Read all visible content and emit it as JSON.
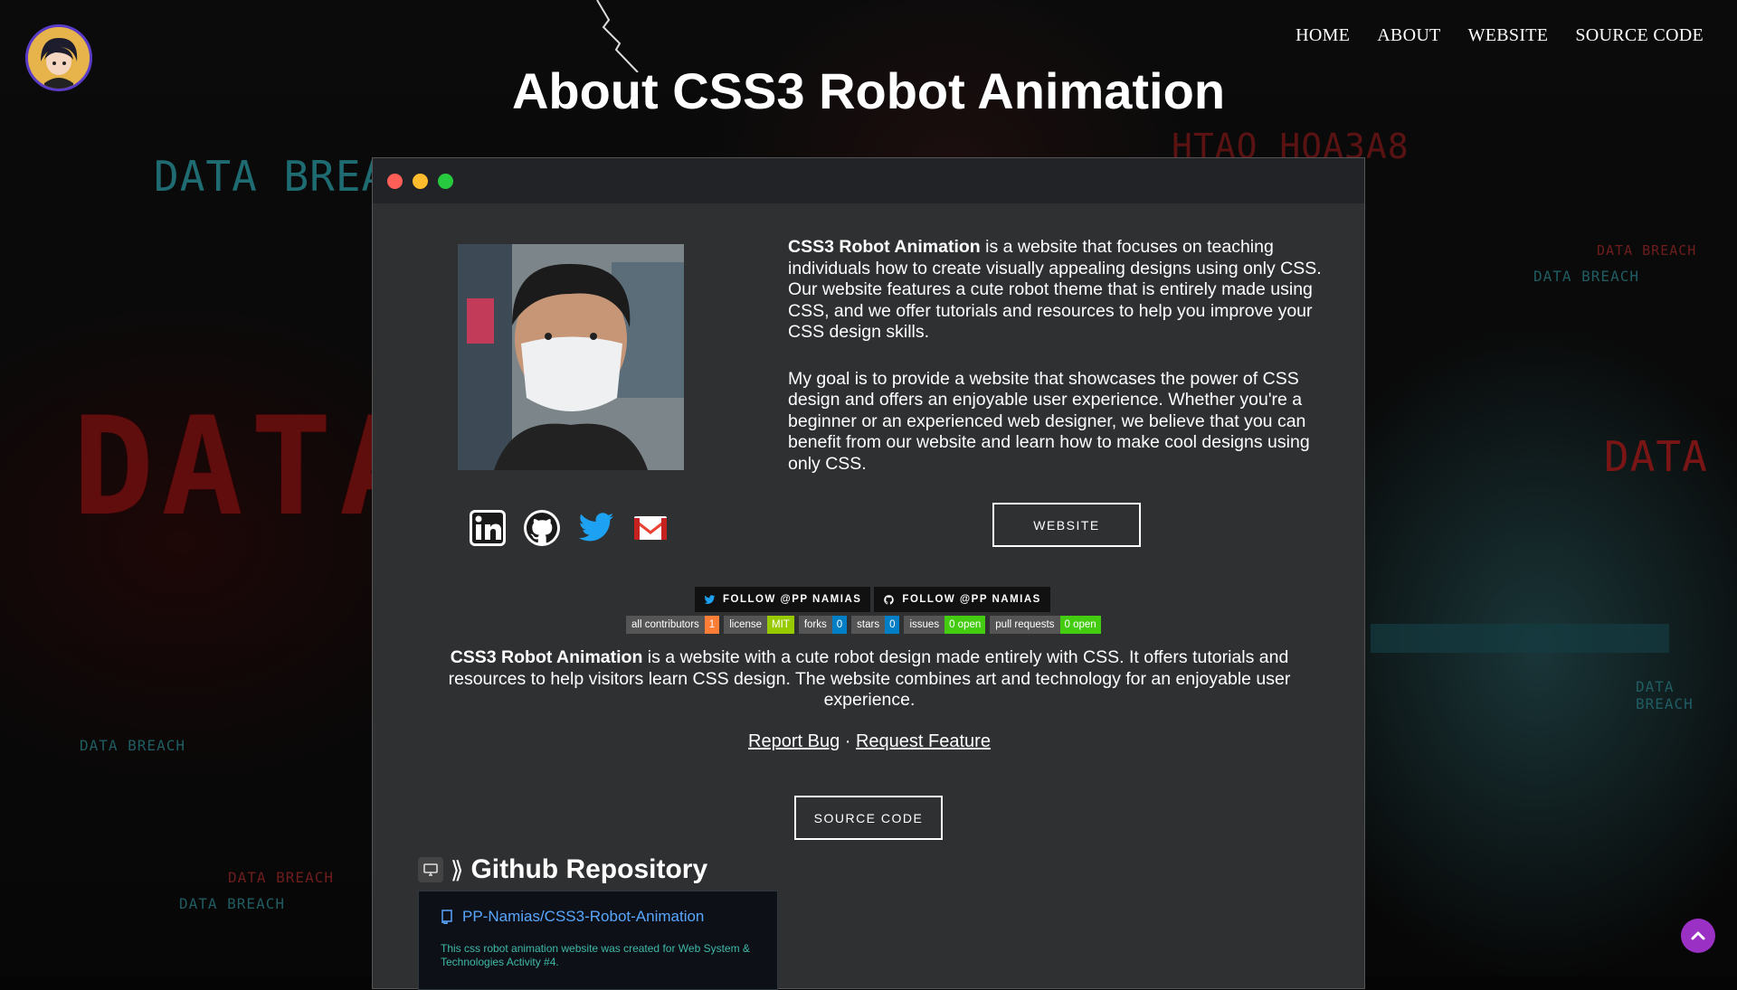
{
  "background": {
    "texts": [
      "DATA BREACH",
      "DATA BREACH",
      "DATA BREACH",
      "DATA BREACH",
      "DATA BREACH",
      "DATA BREACH",
      "DATA",
      "DATA BREACH",
      "HTAO HOA3A8"
    ],
    "big_text": "DATA"
  },
  "nav": {
    "items": [
      "HOME",
      "ABOUT",
      "WEBSITE",
      "SOURCE CODE"
    ]
  },
  "page": {
    "title": "About CSS3 Robot Animation"
  },
  "about": {
    "p1_bold": "CSS3 Robot Animation",
    "p1_rest": " is a website that focuses on teaching individuals how to create visually appealing designs using only CSS. Our website features a cute robot theme that is entirely made using CSS, and we offer tutorials and resources to help you improve your CSS design skills.",
    "p2": "My goal is to provide a website that showcases the power of CSS design and offers an enjoyable user experience. Whether you're a beginner or an experienced web designer, we believe that you can benefit from our website and learn how to make cool designs using only CSS."
  },
  "socials": [
    "linkedin-icon",
    "github-icon",
    "twitter-icon",
    "gmail-icon"
  ],
  "buttons": {
    "website": "WEBSITE",
    "source": "SOURCE CODE"
  },
  "follow": {
    "twitter": "FOLLOW @PP NAMIAS",
    "github": "FOLLOW @PP NAMIAS"
  },
  "badges": [
    {
      "key": "all contributors",
      "value": "1",
      "color": "#fe7d37"
    },
    {
      "key": "license",
      "value": "MIT",
      "color": "#97ca00"
    },
    {
      "key": "forks",
      "value": "0",
      "color": "#007ec6"
    },
    {
      "key": "stars",
      "value": "0",
      "color": "#007ec6"
    },
    {
      "key": "issues",
      "value": "0 open",
      "color": "#4c1"
    },
    {
      "key": "pull requests",
      "value": "0 open",
      "color": "#4c1"
    }
  ],
  "summary": {
    "bold": "CSS3 Robot Animation",
    "rest": " is a website with a cute robot design made entirely with CSS. It offers tutorials and resources to help visitors learn CSS design. The website combines art and technology for an enjoyable user experience."
  },
  "links": {
    "report": "Report Bug",
    "sep": " · ",
    "request": "Request Feature"
  },
  "github": {
    "heading": "Github Repository",
    "repo": "PP-Namias/CSS3-Robot-Animation",
    "description": "This css robot animation website was created for Web System & Technologies Activity #4."
  },
  "colors": {
    "window_bg": "#2f3032",
    "title_bar": "#222326",
    "close": "#ff5f56",
    "minimize": "#ffbd2e",
    "maximize": "#27c93f",
    "scroll_top": "#9b30c4"
  }
}
